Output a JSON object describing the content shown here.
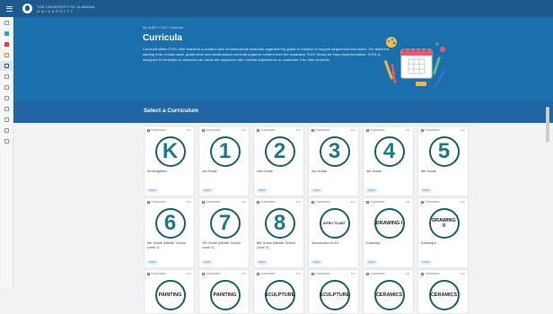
{
  "brand": {
    "line1": "THE UNIVERSITY OF ALABAMA",
    "line2": "UNIVERSITY"
  },
  "sidebar": {
    "items": [
      {
        "icon": "home-icon"
      },
      {
        "icon": "chat-icon"
      },
      {
        "icon": "book-icon"
      },
      {
        "icon": "shapes-icon"
      },
      {
        "icon": "curricula-icon",
        "active": true
      },
      {
        "icon": "document-icon"
      },
      {
        "icon": "list-icon"
      },
      {
        "icon": "calendar-icon"
      },
      {
        "icon": "video-icon"
      },
      {
        "icon": "note-icon"
      },
      {
        "icon": "settings-icon"
      },
      {
        "icon": "image-icon"
      }
    ]
  },
  "hero": {
    "breadcrumb": "My HUB2 / FLEX / Curricula",
    "title": "Curricula",
    "description": "Curricula within FLEX offer teachers a curated view of instructional materials organized by grade or medium to support sequenced instruction. For teachers starting from a blank slate, grade-level and media-based curricula organize content from the expansive FLEX library for easy implementation. FLEX is designed for flexibility so teachers can follow the sequence with minimal adjustments or customize it for their students."
  },
  "section": {
    "title": "Select a Curriculum"
  },
  "card_kind_label": "Curriculum",
  "card_more": "•••",
  "cards": [
    {
      "badge": "K",
      "name": "Kindergarten",
      "tag": "FLEX"
    },
    {
      "badge": "1",
      "name": "1st Grade",
      "tag": "FLEX"
    },
    {
      "badge": "2",
      "name": "2nd Grade",
      "tag": "FLEX"
    },
    {
      "badge": "3",
      "name": "3rd Grade",
      "tag": "FLEX"
    },
    {
      "badge": "4",
      "name": "4th Grade",
      "tag": "FLEX"
    },
    {
      "badge": "5",
      "name": "5th Grade",
      "tag": "FLEX"
    },
    {
      "badge": "6",
      "name": "6th Grade (Middle School Level 1)",
      "tag": "FLEX"
    },
    {
      "badge": "7",
      "name": "7th Grade (Middle School Level 2)",
      "tag": "FLEX"
    },
    {
      "badge": "8",
      "name": "8th Grade (Middle School Level 3)",
      "tag": "FLEX"
    },
    {
      "badge_word": "INTRO TO ART",
      "small": true,
      "name": "Introduction to Art",
      "tag": "FLEX"
    },
    {
      "badge_word": "DRAWING I",
      "name": "Drawing I",
      "tag": "FLEX"
    },
    {
      "badge_word": "DRAWING II",
      "name": "Drawing II",
      "tag": "FLEX"
    },
    {
      "badge_word": "PAINTING",
      "name": "",
      "tag": ""
    },
    {
      "badge_word": "PAINTING",
      "name": "",
      "tag": ""
    },
    {
      "badge_word": "SCULPTURE",
      "name": "",
      "tag": ""
    },
    {
      "badge_word": "SCULPTURE",
      "name": "",
      "tag": ""
    },
    {
      "badge_word": "CERAMICS",
      "name": "",
      "tag": ""
    },
    {
      "badge_word": "CERAMICS",
      "name": "",
      "tag": ""
    }
  ],
  "colors": {
    "topbar": "#1c5a8e",
    "hero": "#1c6fad",
    "section_band": "#2166a3",
    "badge_teal": "#1e7a80",
    "tag_blue": "#2a7dc2"
  }
}
